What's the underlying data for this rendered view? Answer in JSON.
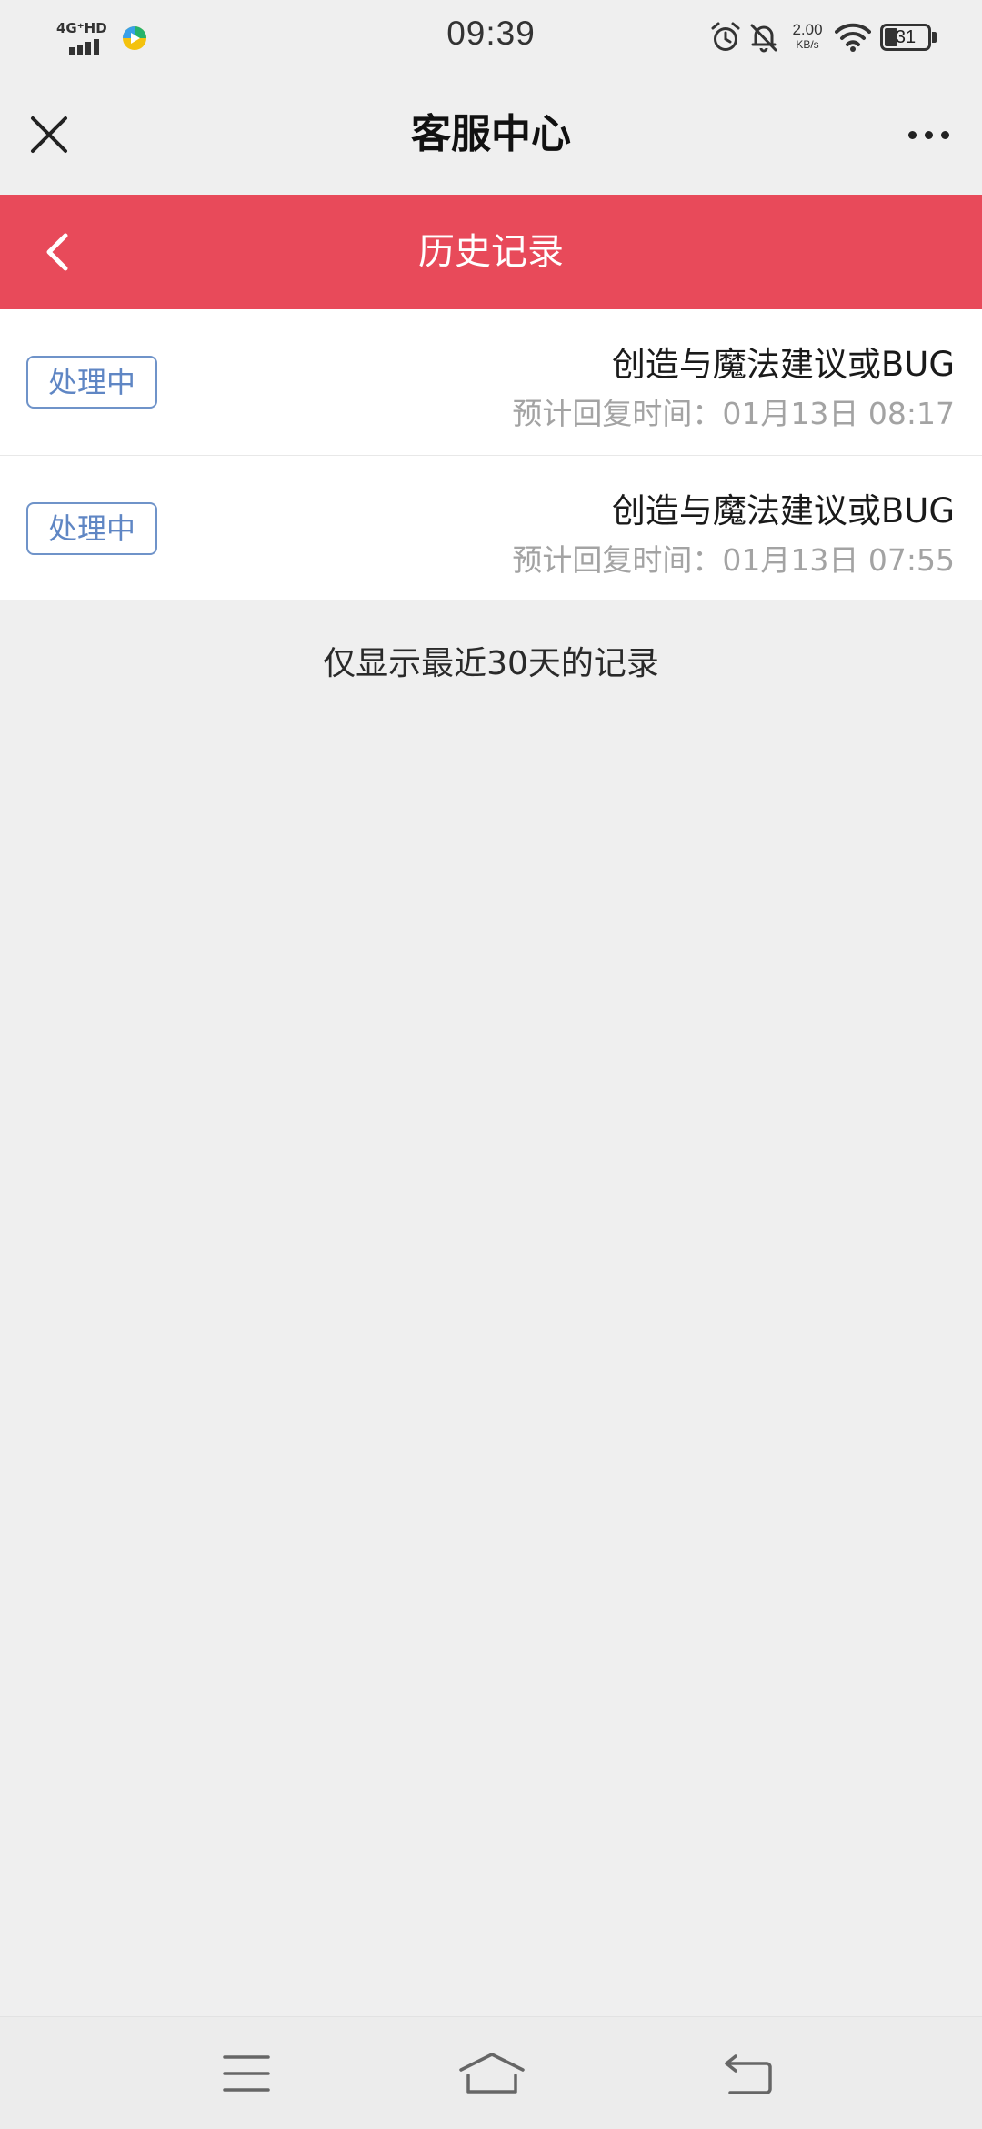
{
  "status_bar": {
    "network": "4G⁺HD",
    "time": "09:39",
    "speed_value": "2.00",
    "speed_unit": "KB/s",
    "battery_level": "31",
    "icons": [
      "signal-icon",
      "app-icon",
      "alarm-icon",
      "mute-icon",
      "wifi-icon",
      "battery-icon"
    ]
  },
  "app_bar": {
    "title": "客服中心",
    "close_icon": "close-icon",
    "more_icon": "more-icon"
  },
  "header": {
    "title": "历史记录",
    "back_icon": "back-icon",
    "color": "#e84a5a"
  },
  "records": [
    {
      "status": "处理中",
      "title": "创造与魔法建议或BUG",
      "time": "预计回复时间：01月13日 08:17"
    },
    {
      "status": "处理中",
      "title": "创造与魔法建议或BUG",
      "time": "预计回复时间：01月13日 07:55"
    }
  ],
  "footer_note": "仅显示最近30天的记录",
  "nav_bar": {
    "icons": [
      "menu-icon",
      "home-icon",
      "back-nav-icon"
    ]
  },
  "colors": {
    "accent": "#e84a5a",
    "tag": "#5f86c4",
    "background": "#efefef"
  }
}
